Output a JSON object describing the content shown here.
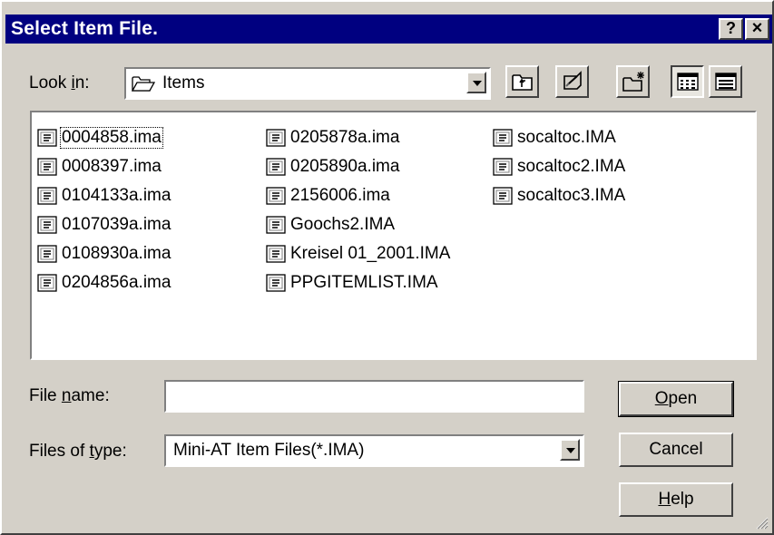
{
  "window": {
    "title": "Select Item File.",
    "help_label": "?",
    "close_label": "×"
  },
  "look_in": {
    "label_pre": "Look ",
    "label_mn": "i",
    "label_post": "n:",
    "value": "Items"
  },
  "toolbar": {
    "icons": [
      "up-one-level-icon",
      "desktop-icon",
      "new-folder-icon",
      "list-view-icon",
      "details-view-icon"
    ]
  },
  "files": {
    "columns": [
      [
        "0004858.ima",
        "0008397.ima",
        "0104133a.ima",
        "0107039a.ima",
        "0108930a.ima",
        "0204856a.ima"
      ],
      [
        "0205878a.ima",
        "0205890a.ima",
        "2156006.ima",
        "Goochs2.IMA",
        "Kreisel 01_2001.IMA",
        "PPGITEMLIST.IMA"
      ],
      [
        "socaltoc.IMA",
        "socaltoc2.IMA",
        "socaltoc3.IMA"
      ]
    ]
  },
  "file_name": {
    "label_pre": "File ",
    "label_mn": "n",
    "label_post": "ame:",
    "value": ""
  },
  "file_type": {
    "label_pre": "Files of ",
    "label_mn": "t",
    "label_post": "ype:",
    "value": "Mini-AT Item Files(*.IMA)"
  },
  "buttons": {
    "open": {
      "mn": "O",
      "rest": "pen"
    },
    "cancel": "Cancel",
    "help": {
      "mn": "H",
      "rest": "elp"
    }
  },
  "colors": {
    "face": "#d4d0c8",
    "titlebar": "#000080",
    "window": "#ffffff"
  }
}
